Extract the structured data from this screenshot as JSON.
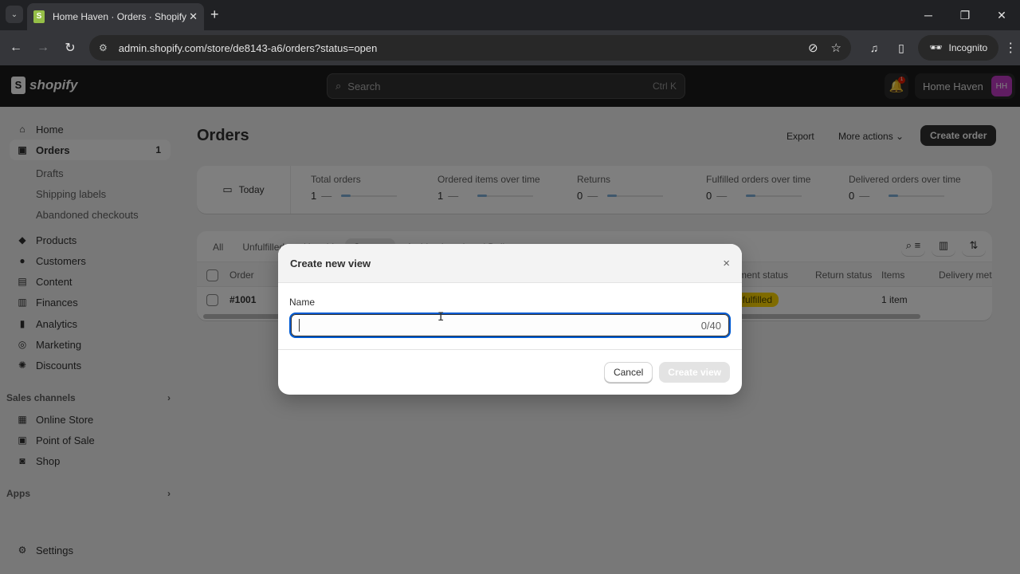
{
  "browser": {
    "tab_title": "Home Haven · Orders · Shopify",
    "favicon": "shopify-bag",
    "url": "admin.shopify.com/store/de8143-a6/orders?status=open",
    "profile_label": "Incognito",
    "icons": {
      "tab_search": "⌄",
      "close_tab": "✕",
      "new_tab": "+",
      "minimize": "─",
      "restore": "❐",
      "close": "✕",
      "back": "←",
      "forward": "→",
      "reload": "↻",
      "site_info": "⚙",
      "eye_off": "⊘",
      "star": "☆",
      "media": "♫",
      "side_panel": "▯",
      "incognito": "🕶",
      "menu": "⋮"
    }
  },
  "topbar": {
    "logo_text": "shopify",
    "logo_glyph": "S",
    "search_placeholder": "Search",
    "search_shortcut": "Ctrl K",
    "search_icon": "⌕",
    "bell_icon": "🔔",
    "notification_count": "1",
    "store_name": "Home Haven",
    "avatar_initials": "HH"
  },
  "sidebar": {
    "items": [
      {
        "label": "Home",
        "icon": "⌂"
      },
      {
        "label": "Orders",
        "icon": "▣",
        "count": "1",
        "active": true
      },
      {
        "label": "Products",
        "icon": "◆"
      },
      {
        "label": "Customers",
        "icon": "●"
      },
      {
        "label": "Content",
        "icon": "▤"
      },
      {
        "label": "Finances",
        "icon": "▥"
      },
      {
        "label": "Analytics",
        "icon": "▮"
      },
      {
        "label": "Marketing",
        "icon": "◎"
      },
      {
        "label": "Discounts",
        "icon": "✺"
      }
    ],
    "order_subitems": [
      "Drafts",
      "Shipping labels",
      "Abandoned checkouts"
    ],
    "sales_channels_label": "Sales channels",
    "sales_channels": [
      {
        "label": "Online Store",
        "icon": "▦"
      },
      {
        "label": "Point of Sale",
        "icon": "▣"
      },
      {
        "label": "Shop",
        "icon": "◙"
      }
    ],
    "apps_label": "Apps",
    "chevron": "›",
    "settings": {
      "label": "Settings",
      "icon": "⚙"
    }
  },
  "page": {
    "title": "Orders",
    "export_label": "Export",
    "more_actions_label": "More actions ⌄",
    "create_order_label": "Create order"
  },
  "metrics": {
    "date_label": "Today",
    "calendar_icon": "▭",
    "items": [
      {
        "label": "Total orders",
        "value": "1"
      },
      {
        "label": "Ordered items over time",
        "value": "1"
      },
      {
        "label": "Returns",
        "value": "0"
      },
      {
        "label": "Fulfilled orders over time",
        "value": "0"
      },
      {
        "label": "Delivered orders over time",
        "value": "0"
      }
    ],
    "trend_dash": "—"
  },
  "orders_table": {
    "views": [
      "All",
      "Unfulfilled",
      "Unpaid",
      "Open ⌄",
      "Archived",
      "Local Delivery",
      "+"
    ],
    "selected_view": "Open",
    "tool_icons": {
      "search_filter": "⌕ ≡",
      "columns": "▥",
      "sort": "⇅"
    },
    "columns": [
      "Order",
      "Fulfillment status",
      "Return status",
      "Items",
      "Delivery method"
    ],
    "visible_header_fragments": {
      "fulfillment": "ment status",
      "delivery": "Delivery met"
    },
    "rows": [
      {
        "order": "#1001",
        "fulfillment_status": "Unfulfilled",
        "fulfillment_visible": "nfulfilled",
        "return_status": "",
        "items": "1 item",
        "delivery_method": ""
      }
    ]
  },
  "modal": {
    "title": "Create new view",
    "close_icon": "×",
    "name_label": "Name",
    "name_value": "",
    "name_placeholder": "",
    "char_counter": "0/40",
    "cancel_label": "Cancel",
    "create_label": "Create view"
  },
  "cursor": "I"
}
